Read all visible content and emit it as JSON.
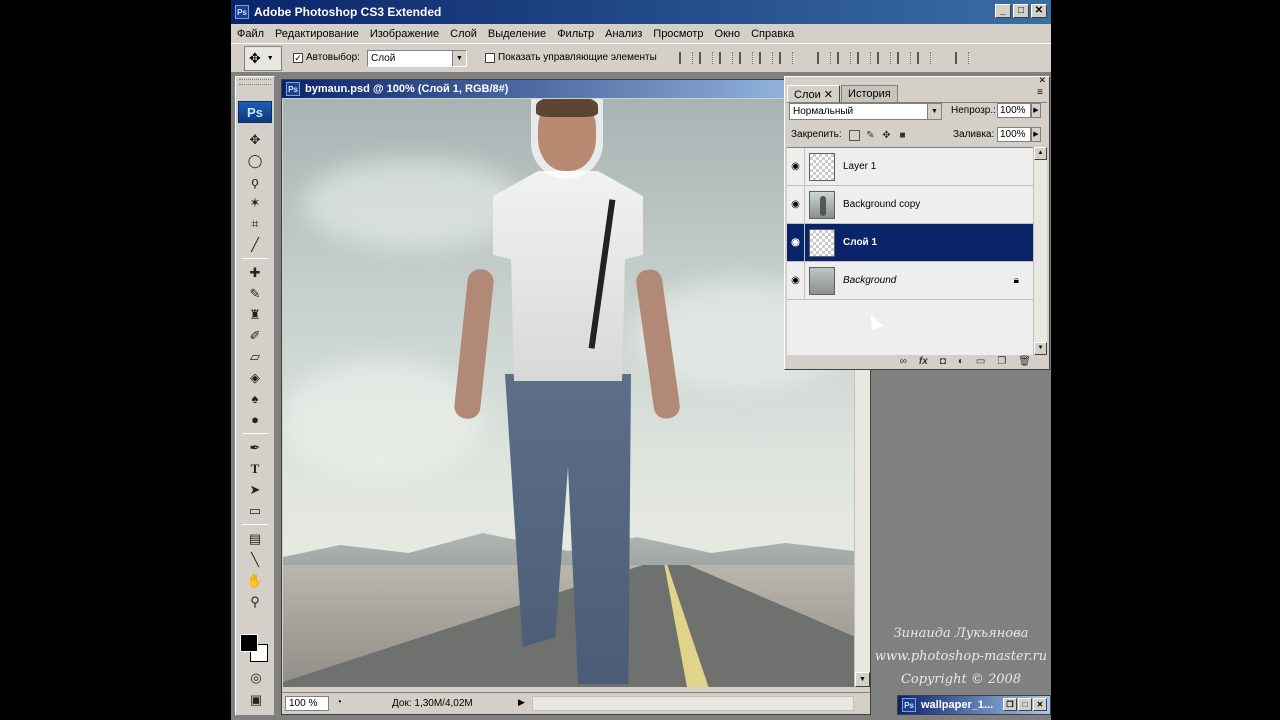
{
  "app": {
    "title": "Adobe Photoshop CS3 Extended",
    "icon_text": "Ps",
    "window_buttons": [
      "_",
      "□",
      "✕"
    ]
  },
  "menu": [
    "Файл",
    "Редактирование",
    "Изображение",
    "Слой",
    "Выделение",
    "Фильтр",
    "Анализ",
    "Просмотр",
    "Окно",
    "Справка"
  ],
  "options": {
    "autoselect_label": "Автовыбор:",
    "autoselect_value": "Слой",
    "show_controls_label": "Показать управляющие элементы"
  },
  "toolbox": {
    "logo": "Ps",
    "tools": [
      "move-tool",
      "marquee-tool",
      "lasso-tool",
      "magic-wand-tool",
      "crop-tool",
      "eyedropper-tool",
      "healing-tool",
      "brush-tool",
      "stamp-tool",
      "history-brush-tool",
      "eraser-tool",
      "bucket-tool",
      "blur-tool",
      "dodge-tool",
      "pen-tool",
      "type-tool",
      "path-select-tool",
      "shape-tool",
      "notes-tool",
      "eyedropper2-tool",
      "hand-tool",
      "zoom-tool"
    ],
    "type_glyph": "T"
  },
  "document": {
    "title": "bymaun.psd @ 100% (Слой 1, RGB/8#)",
    "zoom": "100 %",
    "doc_size": "Док: 1,30M/4,02M"
  },
  "layers_panel": {
    "tabs": [
      "Слои",
      "История"
    ],
    "blend_mode": "Нормальный",
    "opacity_label": "Непрозр.:",
    "opacity_value": "100%",
    "lock_label": "Закрепить:",
    "fill_label": "Заливка:",
    "fill_value": "100%",
    "layers": [
      {
        "name": "Layer 1",
        "selected": false,
        "italic": false,
        "locked": false
      },
      {
        "name": "Background copy",
        "selected": false,
        "italic": false,
        "locked": false
      },
      {
        "name": "Слой 1",
        "selected": true,
        "italic": false,
        "locked": false
      },
      {
        "name": "Background",
        "selected": false,
        "italic": true,
        "locked": true
      }
    ]
  },
  "credits": {
    "author": "Зинаида Лукьянова",
    "site": "www.photoshop-master.ru",
    "copyright": "Copyright © 2008"
  },
  "minimized_window": {
    "title": "wallpaper_1..."
  },
  "colors": {
    "titlebar": "#0a246a",
    "selection": "#0a246a",
    "chrome": "#d4d0c8"
  }
}
